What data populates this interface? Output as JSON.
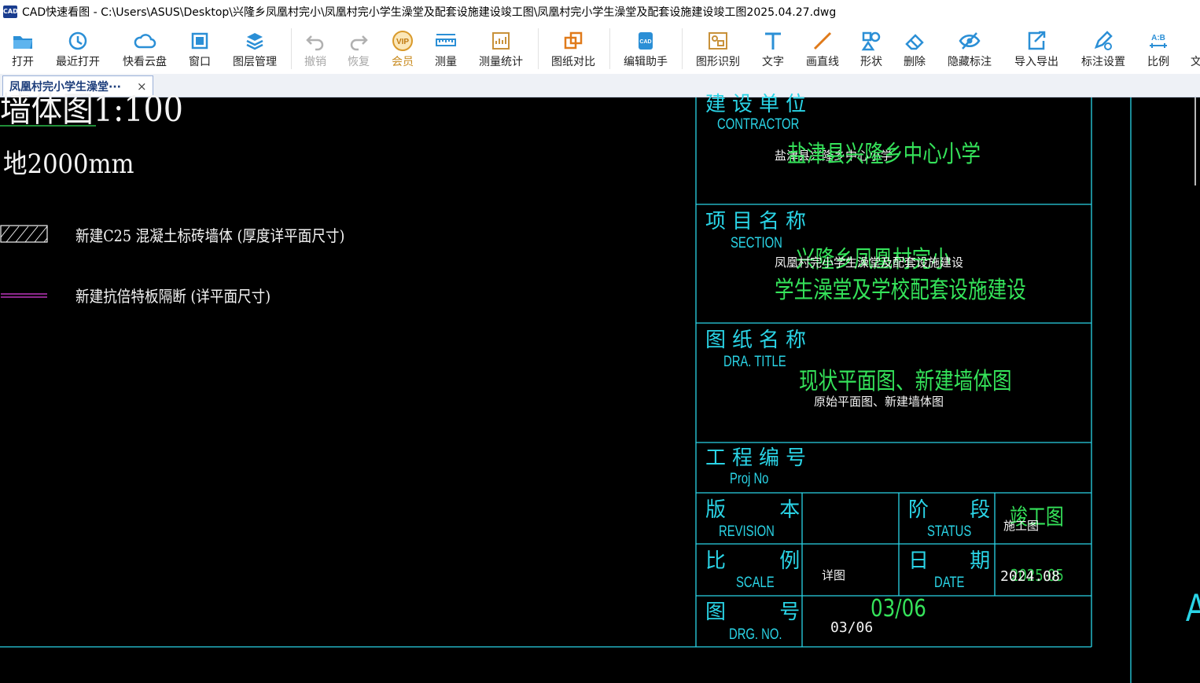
{
  "window": {
    "title": "CAD快速看图 - C:\\Users\\ASUS\\Desktop\\兴隆乡凤凰村完小\\凤凰村完小学生澡堂及配套设施建设竣工图\\凤凰村完小学生澡堂及配套设施建设竣工图2025.04.27.dwg",
    "app_icon_text": "CAD"
  },
  "toolbar": {
    "open": "打开",
    "recent": "最近打开",
    "cloud": "快看云盘",
    "window": "窗口",
    "layers": "图层管理",
    "undo": "撤销",
    "redo": "恢复",
    "vip": "会员",
    "measure": "测量",
    "measure_stats": "测量统计",
    "compare": "图纸对比",
    "edit_helper": "编辑助手",
    "shape_recognize": "图形识别",
    "text": "文字",
    "line": "画直线",
    "shape": "形状",
    "delete": "删除",
    "hide_mark": "隐藏标注",
    "import_export": "导入导出",
    "mark_settings": "标注设置",
    "scale": "比例",
    "more": "文"
  },
  "tab": {
    "label": "凤凰村完小学生澡堂···",
    "close": "×"
  },
  "drawing": {
    "cut_title": "墙体图1:100",
    "elevation_note": "地2000mm",
    "legend": [
      {
        "label": "新建C25 混凝土标砖墙体 (厚度详平面尺寸)"
      },
      {
        "label": "新建抗倍特板隔断 (详平面尺寸)"
      }
    ],
    "far_right_letter": "A",
    "title_block": {
      "contractor_cn": "建设单位",
      "contractor_en": "CONTRACTOR",
      "contractor_value_white": "盐津县兴隆乡中心小学",
      "contractor_value_green": "盐津县兴隆乡中心小学",
      "section_cn": "项目名称",
      "section_en": "SECTION",
      "section_value_white": "凤凰村完小学生澡堂及配套设施建设",
      "section_value_green_1": "兴隆乡凤凰村完小",
      "section_value_green_2": "学生澡堂及学校配套设施建设",
      "title_cn": "图纸名称",
      "title_en": "DRA. TITLE",
      "title_value_green": "现状平面图、新建墙体图",
      "title_value_white": "原始平面图、新建墙体图",
      "proj_cn": "工程编号",
      "proj_en": "Proj No",
      "revision_cn": "版 本",
      "revision_en": "REVISION",
      "status_cn": "阶 段",
      "status_en": "STATUS",
      "status_value_green": "竣工图",
      "status_value_white": "施工图",
      "scale_cn": "比 例",
      "scale_en": "SCALE",
      "scale_value": "详图",
      "date_cn": "日 期",
      "date_en": "DATE",
      "date_value_white": "2024.08",
      "date_value_green": "2025.05",
      "drg_cn": "图 号",
      "drg_en": "DRG. NO.",
      "drg_value_green": "03/06",
      "drg_value_white": "03/06"
    }
  },
  "colors": {
    "cad_cyan": "#2ad4e6",
    "cad_green": "#35e35a",
    "cad_white": "#f4f4f4",
    "cad_magenta": "#e040e0",
    "toolbar_blue": "#2b8fd6"
  }
}
